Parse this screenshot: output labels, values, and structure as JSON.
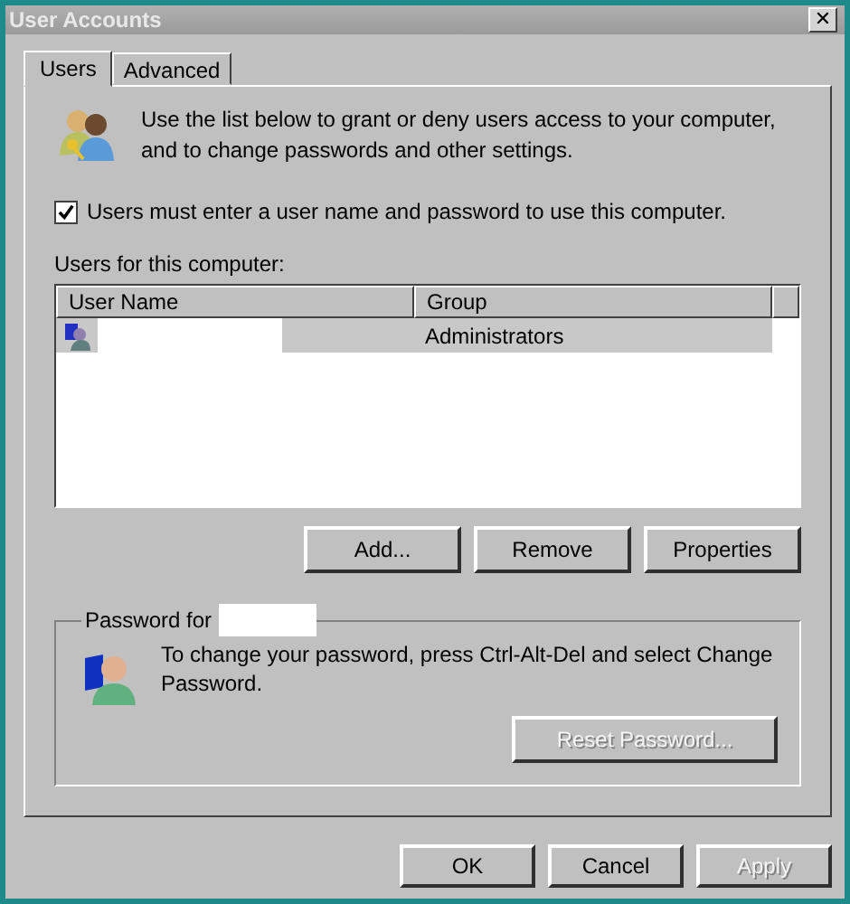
{
  "window": {
    "title": "User Accounts",
    "close": "✕"
  },
  "tabs": [
    {
      "label": "Users",
      "selected": true
    },
    {
      "label": "Advanced",
      "selected": false
    }
  ],
  "intro": "Use the list below to grant or deny users access to your computer, and to change passwords and other settings.",
  "require_login": {
    "label": "Users must enter a user name and password to use this computer.",
    "checked": true
  },
  "users_label": "Users for this computer:",
  "table": {
    "columns": [
      "User Name",
      "Group"
    ],
    "rows": [
      {
        "group": "Administrators",
        "selected": true
      }
    ]
  },
  "list_buttons": [
    {
      "label": "Add...",
      "disabled": false
    },
    {
      "label": "Remove",
      "disabled": false
    },
    {
      "label": "Properties",
      "disabled": false
    }
  ],
  "password_group": {
    "legend": "Password for",
    "text": "To change your password, press Ctrl-Alt-Del and select Change Password.",
    "button": {
      "label": "Reset Password...",
      "disabled": true
    }
  },
  "dialog_buttons": [
    {
      "label": "OK",
      "disabled": false
    },
    {
      "label": "Cancel",
      "disabled": false
    },
    {
      "label": "Apply",
      "disabled": true
    }
  ]
}
